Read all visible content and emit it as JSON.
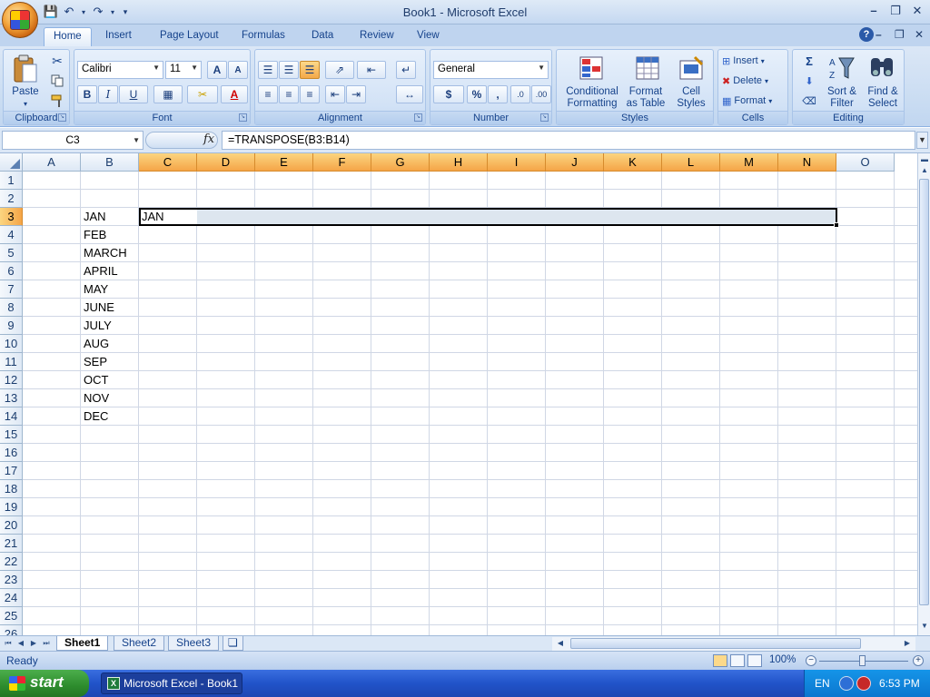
{
  "window": {
    "title": "Book1 - Microsoft Excel"
  },
  "ribbon": {
    "tabs": [
      "Home",
      "Insert",
      "Page Layout",
      "Formulas",
      "Data",
      "Review",
      "View"
    ],
    "active_tab": "Home",
    "clipboard": {
      "paste": "Paste",
      "label": "Clipboard"
    },
    "font": {
      "name": "Calibri",
      "size": "11",
      "label": "Font",
      "bold": "B",
      "italic": "I",
      "underline": "U",
      "grow": "A",
      "shrink": "A",
      "color": "A"
    },
    "alignment": {
      "label": "Alignment"
    },
    "number": {
      "format": "General",
      "label": "Number",
      "currency": "$",
      "percent": "%",
      "comma": ","
    },
    "styles": {
      "conditional1": "Conditional",
      "conditional2": "Formatting",
      "table1": "Format",
      "table2": "as Table",
      "cell1": "Cell",
      "cell2": "Styles",
      "label": "Styles"
    },
    "cells": {
      "insert": "Insert",
      "delete": "Delete",
      "format": "Format",
      "label": "Cells"
    },
    "editing": {
      "sigma": "Σ",
      "sort1": "Sort &",
      "sort2": "Filter",
      "find1": "Find &",
      "find2": "Select",
      "label": "Editing"
    }
  },
  "formula_bar": {
    "name_box": "C3",
    "fx": "fx",
    "formula": "=TRANSPOSE(B3:B14)"
  },
  "grid": {
    "columns": [
      "A",
      "B",
      "C",
      "D",
      "E",
      "F",
      "G",
      "H",
      "I",
      "J",
      "K",
      "L",
      "M",
      "N",
      "O"
    ],
    "rows": [
      "1",
      "2",
      "3",
      "4",
      "5",
      "6",
      "7",
      "8",
      "9",
      "10",
      "11",
      "12",
      "13",
      "14",
      "15",
      "16",
      "17",
      "18",
      "19",
      "20",
      "21",
      "22",
      "23",
      "24",
      "25",
      "26"
    ],
    "column_b_values": [
      "JAN",
      "FEB",
      "MARCH",
      "APRIL",
      "MAY",
      "JUNE",
      "JULY",
      "AUG",
      "SEP",
      "OCT",
      "NOV",
      "DEC"
    ],
    "c3_value": "JAN",
    "selected_columns": [
      "C",
      "D",
      "E",
      "F",
      "G",
      "H",
      "I",
      "J",
      "K",
      "L",
      "M",
      "N"
    ],
    "selected_row": "3"
  },
  "sheets": {
    "tabs": [
      "Sheet1",
      "Sheet2",
      "Sheet3"
    ],
    "active": "Sheet1"
  },
  "status": {
    "text": "Ready",
    "zoom": "100%"
  },
  "taskbar": {
    "start": "start",
    "task": "Microsoft Excel - Book1",
    "lang": "EN",
    "clock": "6:53 PM"
  }
}
